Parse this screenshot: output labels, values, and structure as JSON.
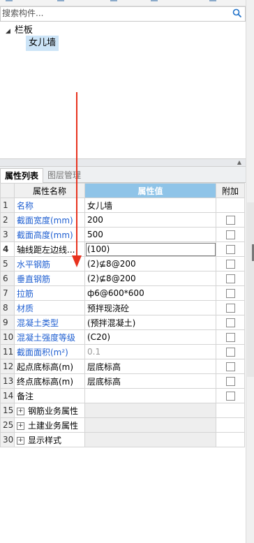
{
  "search": {
    "placeholder": "搜索构件..."
  },
  "tree": {
    "root_label": "栏板",
    "child_label": "女儿墙"
  },
  "tabs": [
    {
      "label": "属性列表"
    },
    {
      "label": "图层管理"
    }
  ],
  "grid": {
    "headers": {
      "name": "属性名称",
      "value": "属性值",
      "add": "附加"
    },
    "rows": [
      {
        "num": "1",
        "name": "名称",
        "value": "女儿墙",
        "has_checkbox": false
      },
      {
        "num": "2",
        "name": "截面宽度(mm)",
        "value": "200",
        "has_checkbox": true
      },
      {
        "num": "3",
        "name": "截面高度(mm)",
        "value": "500",
        "has_checkbox": true
      },
      {
        "num": "4",
        "name": "轴线距左边线...",
        "value": "(100)",
        "has_checkbox": true
      },
      {
        "num": "5",
        "name": "水平钢筋",
        "value": "(2)⊈8@200",
        "has_checkbox": true
      },
      {
        "num": "6",
        "name": "垂直钢筋",
        "value": "(2)⊈8@200",
        "has_checkbox": true
      },
      {
        "num": "7",
        "name": "拉筋",
        "value": "ф6@600*600",
        "has_checkbox": true
      },
      {
        "num": "8",
        "name": "材质",
        "value": "预拌现浇砼",
        "has_checkbox": true
      },
      {
        "num": "9",
        "name": "混凝土类型",
        "value": "(预拌混凝土)",
        "has_checkbox": true
      },
      {
        "num": "10",
        "name": "混凝土强度等级",
        "value": "(C20)",
        "has_checkbox": true
      },
      {
        "num": "11",
        "name": "截面面积(m²)",
        "value": "0.1",
        "has_checkbox": true
      },
      {
        "num": "12",
        "name": "起点底标高(m)",
        "value": "层底标高",
        "has_checkbox": true
      },
      {
        "num": "13",
        "name": "终点底标高(m)",
        "value": "层底标高",
        "has_checkbox": true
      },
      {
        "num": "14",
        "name": "备注",
        "value": "",
        "has_checkbox": true
      },
      {
        "num": "15",
        "name": "钢筋业务属性",
        "value": "",
        "has_checkbox": false
      },
      {
        "num": "25",
        "name": "土建业务属性",
        "value": "",
        "has_checkbox": false
      },
      {
        "num": "30",
        "name": "显示样式",
        "value": "",
        "has_checkbox": false
      }
    ]
  },
  "colors": {
    "header_accent": "#8fc4e8",
    "link_blue": "#1f5fd1",
    "selection": "#cce4f7",
    "annotation_arrow": "#e8321e"
  }
}
